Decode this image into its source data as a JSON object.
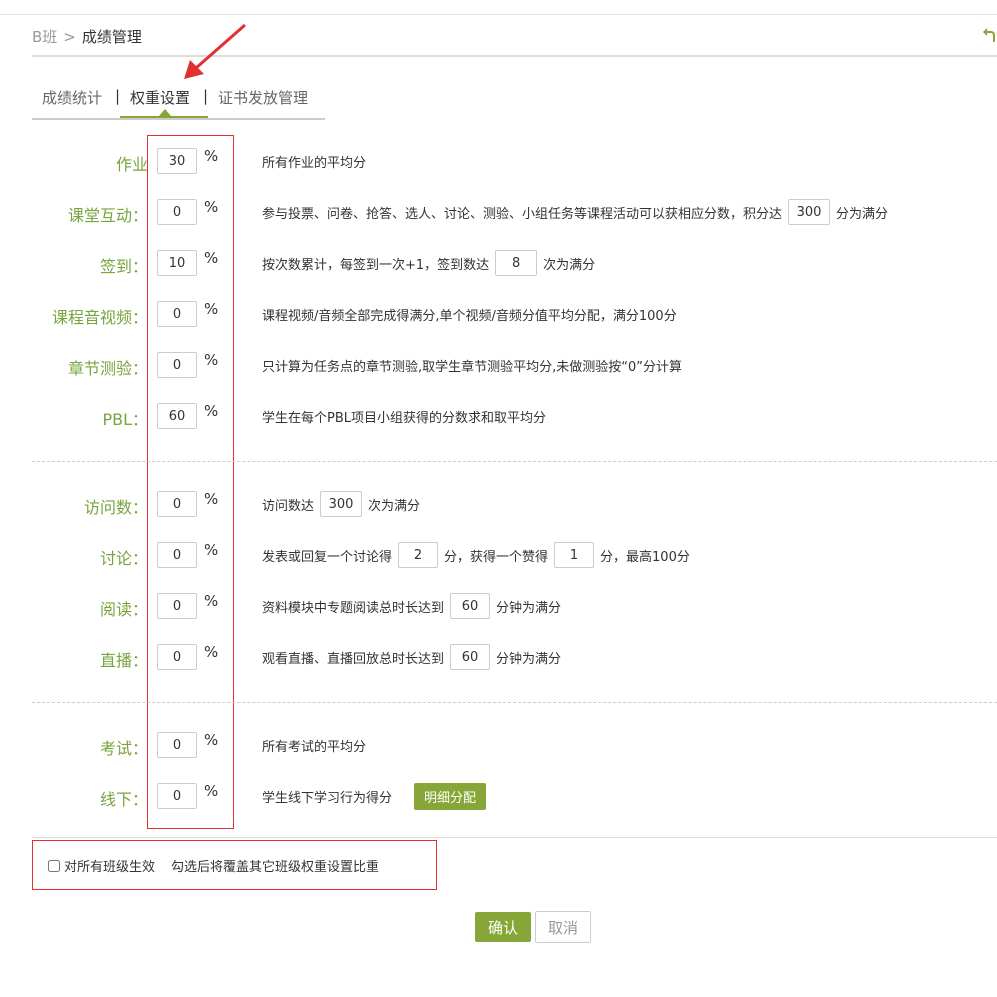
{
  "breadcrumb": {
    "class_name": "B班",
    "separator": ">",
    "current": "成绩管理"
  },
  "tabs": [
    {
      "label": "成绩统计"
    },
    {
      "label": "权重设置",
      "active": true
    },
    {
      "label": "证书发放管理"
    }
  ],
  "tab_separator": "|",
  "percent_sign": "%",
  "weights": {
    "homework": {
      "label": "作业",
      "value": "30",
      "desc": "所有作业的平均分"
    },
    "interaction": {
      "label": "课堂互动：",
      "value": "0",
      "desc_before": "参与投票、问卷、抢答、选人、讨论、测验、小组任务等课程活动可以获相应分数，积分达",
      "threshold": "300",
      "desc_after": "分为满分"
    },
    "signin": {
      "label": "签到：",
      "value": "10",
      "desc_before": "按次数累计，每签到一次+1，签到数达",
      "threshold": "8",
      "desc_after": "次为满分"
    },
    "video": {
      "label": "课程音视频：",
      "value": "0",
      "desc": "课程视频/音频全部完成得满分,单个视频/音频分值平均分配，满分100分"
    },
    "quiz": {
      "label": "章节测验：",
      "value": "0",
      "desc": "只计算为任务点的章节测验,取学生章节测验平均分,未做测验按“0”分计算"
    },
    "pbl": {
      "label": "PBL：",
      "value": "60",
      "desc": "学生在每个PBL项目小组获得的分数求和取平均分"
    },
    "visits": {
      "label": "访问数：",
      "value": "0",
      "desc_before": "访问数达",
      "threshold": "300",
      "desc_after": "次为满分"
    },
    "discussion": {
      "label": "讨论：",
      "value": "0",
      "desc_before": "发表或回复一个讨论得",
      "threshold": "2",
      "desc_mid": "分，获得一个赞得",
      "threshold2": "1",
      "desc_after": "分，最高100分"
    },
    "reading": {
      "label": "阅读：",
      "value": "0",
      "desc_before": "资料模块中专题阅读总时长达到",
      "threshold": "60",
      "desc_after": "分钟为满分"
    },
    "live": {
      "label": "直播：",
      "value": "0",
      "desc_before": "观看直播、直播回放总时长达到",
      "threshold": "60",
      "desc_after": "分钟为满分"
    },
    "exam": {
      "label": "考试：",
      "value": "0",
      "desc": "所有考试的平均分"
    },
    "offline": {
      "label": "线下：",
      "value": "0",
      "desc": "学生线下学习行为得分",
      "button": "明细分配"
    }
  },
  "apply_all": {
    "label": "对所有班级生效",
    "hint": "勾选后将覆盖其它班级权重设置比重",
    "checked": false
  },
  "actions": {
    "confirm": "确认",
    "cancel": "取消"
  },
  "colors": {
    "accent": "#86a737",
    "label_green": "#78a43c",
    "annotation_red": "#e0302f"
  }
}
